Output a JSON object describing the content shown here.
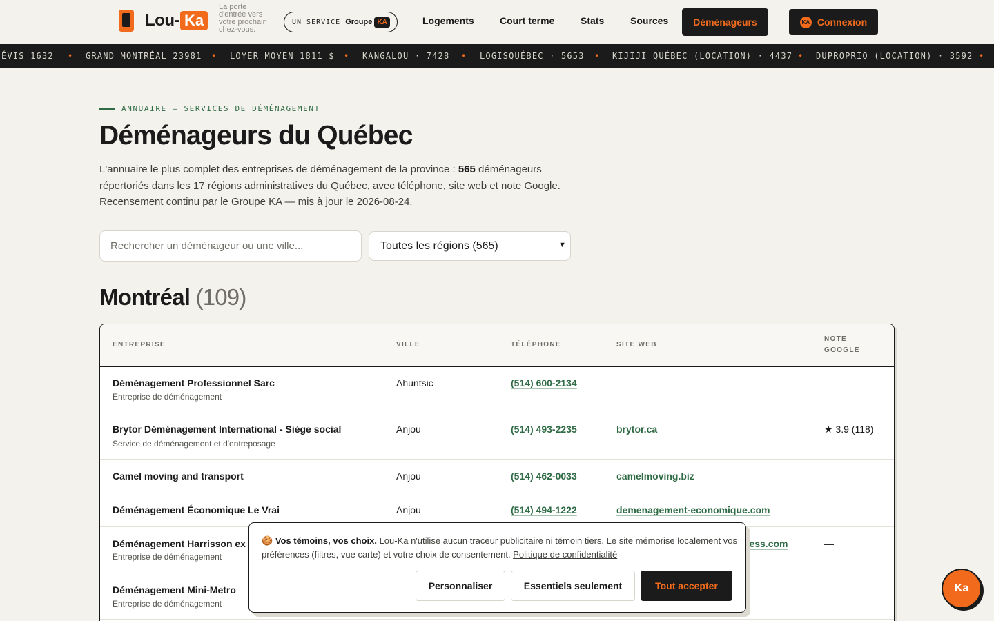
{
  "header": {
    "logo_lou": "Lou-",
    "logo_ka": "Ka",
    "tagline": "La porte d'entrée vers votre prochain chez-vous.",
    "service_prefix": "UN SERVICE",
    "service_group": "Groupe",
    "service_badge": "KA",
    "nav": {
      "logements": "Logements",
      "court_terme": "Court terme",
      "stats": "Stats",
      "sources": "Sources",
      "demenageurs": "Déménageurs"
    },
    "login_badge": "KA",
    "login_label": "Connexion"
  },
  "ticker": {
    "items": [
      "ÉVIS 1632",
      "GRAND MONTRÉAL 23981",
      "LOYER MOYEN 1811 $",
      "KANGALOU · 7428",
      "LOGISQUÉBEC · 5653",
      "KIJIJI QUÉBEC (LOCATION) · 4437",
      "DUPROPRIO (LOCATION) · 3592"
    ],
    "separator": "•"
  },
  "main": {
    "eyebrow": "ANNUAIRE — SERVICES DE DÉMÉNAGEMENT",
    "title": "Déménageurs du Québec",
    "intro_before": "L'annuaire le plus complet des entreprises de déménagement de la province : ",
    "intro_count": "565",
    "intro_after": " déménageurs répertoriés dans les 17 régions administratives du Québec, avec téléphone, site web et note Google. Recensement continu par le Groupe KA — mis à jour le 2026-08-24.",
    "search_placeholder": "Rechercher un déménageur ou une ville...",
    "region_selected": "Toutes les régions (565)",
    "chevron_icon": "chevron-down-icon"
  },
  "section": {
    "title": "Montréal",
    "count": "(109)"
  },
  "table": {
    "headers": [
      "ENTREPRISE",
      "VILLE",
      "TÉLÉPHONE",
      "SITE WEB",
      "NOTE GOOGLE"
    ],
    "rows": [
      {
        "name": "Déménagement Professionnel Sarc",
        "sub": "Entreprise de déménagement",
        "city": "Ahuntsic",
        "phone": "(514) 600-2134",
        "site": "—",
        "rating": "—"
      },
      {
        "name": "Brytor Déménagement International - Siège social",
        "sub": "Service de déménagement et d'entreposage",
        "city": "Anjou",
        "phone": "(514) 493-2235",
        "site": "brytor.ca",
        "rating": "★ 3.9 (118)"
      },
      {
        "name": "Camel moving and transport",
        "sub": "",
        "city": "Anjou",
        "phone": "(514) 462-0033",
        "site": "camelmoving.biz",
        "rating": "—"
      },
      {
        "name": "Déménagement Économique Le Vrai",
        "sub": "",
        "city": "Anjou",
        "phone": "(514) 494-1222",
        "site": "demenagement-economique.com",
        "rating": "—"
      },
      {
        "name": "Déménagement Harrisson ex",
        "sub": "Entreprise de déménagement",
        "city": "",
        "phone": "",
        "site": "ress.com",
        "rating": "—"
      },
      {
        "name": "Déménagement Mini-Metro",
        "sub": "Entreprise de déménagement",
        "city": "",
        "phone": "",
        "site": "",
        "rating": "—"
      }
    ]
  },
  "cookie": {
    "icon": "🍪",
    "title": "Vos témoins, vos choix.",
    "text": " Lou-Ka n'utilise aucun traceur publicitaire ni témoin tiers. Le site mémorise localement vos préférences (filtres, vue carte) et votre choix de consentement. ",
    "policy_link": "Politique de confidentialité",
    "btn_customize": "Personnaliser",
    "btn_essential": "Essentiels seulement",
    "btn_accept": "Tout accepter"
  },
  "chat": {
    "label": "Ka"
  },
  "colors": {
    "accent": "#f26b1d",
    "dark": "#1b1b1b",
    "green": "#2f6b45",
    "background": "#f4f2ec"
  }
}
